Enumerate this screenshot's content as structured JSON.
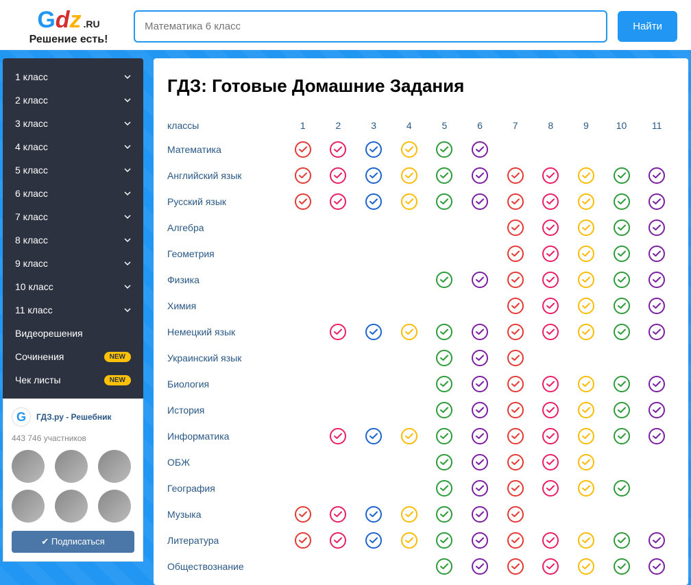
{
  "logo": {
    "g": "G",
    "d": "d",
    "z": "z",
    "ru": ".RU",
    "tagline": "Решение есть!"
  },
  "search": {
    "placeholder": "Математика 6 класс",
    "button": "Найти"
  },
  "nav": [
    {
      "label": "1 класс",
      "expandable": true
    },
    {
      "label": "2 класс",
      "expandable": true
    },
    {
      "label": "3 класс",
      "expandable": true
    },
    {
      "label": "4 класс",
      "expandable": true
    },
    {
      "label": "5 класс",
      "expandable": true
    },
    {
      "label": "6 класс",
      "expandable": true
    },
    {
      "label": "7 класс",
      "expandable": true
    },
    {
      "label": "8 класс",
      "expandable": true
    },
    {
      "label": "9 класс",
      "expandable": true
    },
    {
      "label": "10 класс",
      "expandable": true
    },
    {
      "label": "11 класс",
      "expandable": true
    },
    {
      "label": "Видеорешения",
      "expandable": false
    },
    {
      "label": "Сочинения",
      "expandable": false,
      "badge": "NEW"
    },
    {
      "label": "Чек листы",
      "expandable": false,
      "badge": "NEW"
    }
  ],
  "vk": {
    "title": "ГДЗ.ру - Решебник",
    "count": "443 746 участников",
    "button": "Подписаться"
  },
  "main": {
    "title": "ГДЗ: Готовые Домашние Задания",
    "classes_label": "классы",
    "cols": [
      "1",
      "2",
      "3",
      "4",
      "5",
      "6",
      "7",
      "8",
      "9",
      "10",
      "11"
    ],
    "colors": {
      "1": "#e53935",
      "2": "#e91e63",
      "3": "#1e62d0",
      "4": "#fbbc05",
      "5": "#2e9b3b",
      "6": "#7b1fa2",
      "7": "#e53935",
      "8": "#e91e63",
      "9": "#fbbc05",
      "10": "#2e9b3b",
      "11": "#7b1fa2"
    },
    "subjects": [
      {
        "name": "Математика",
        "grades": [
          1,
          2,
          3,
          4,
          5,
          6
        ]
      },
      {
        "name": "Английский язык",
        "grades": [
          1,
          2,
          3,
          4,
          5,
          6,
          7,
          8,
          9,
          10,
          11
        ]
      },
      {
        "name": "Русский язык",
        "grades": [
          1,
          2,
          3,
          4,
          5,
          6,
          7,
          8,
          9,
          10,
          11
        ]
      },
      {
        "name": "Алгебра",
        "grades": [
          7,
          8,
          9,
          10,
          11
        ]
      },
      {
        "name": "Геометрия",
        "grades": [
          7,
          8,
          9,
          10,
          11
        ]
      },
      {
        "name": "Физика",
        "grades": [
          5,
          6,
          7,
          8,
          9,
          10,
          11
        ]
      },
      {
        "name": "Химия",
        "grades": [
          7,
          8,
          9,
          10,
          11
        ]
      },
      {
        "name": "Немецкий язык",
        "grades": [
          2,
          3,
          4,
          5,
          6,
          7,
          8,
          9,
          10,
          11
        ]
      },
      {
        "name": "Украинский язык",
        "grades": [
          5,
          6,
          7
        ]
      },
      {
        "name": "Биология",
        "grades": [
          5,
          6,
          7,
          8,
          9,
          10,
          11
        ]
      },
      {
        "name": "История",
        "grades": [
          5,
          6,
          7,
          8,
          9,
          10,
          11
        ]
      },
      {
        "name": "Информатика",
        "grades": [
          2,
          3,
          4,
          5,
          6,
          7,
          8,
          9,
          10,
          11
        ]
      },
      {
        "name": "ОБЖ",
        "grades": [
          5,
          6,
          7,
          8,
          9
        ]
      },
      {
        "name": "География",
        "grades": [
          5,
          6,
          7,
          8,
          9,
          10
        ]
      },
      {
        "name": "Музыка",
        "grades": [
          1,
          2,
          3,
          4,
          5,
          6,
          7
        ]
      },
      {
        "name": "Литература",
        "grades": [
          1,
          2,
          3,
          4,
          5,
          6,
          7,
          8,
          9,
          10,
          11
        ]
      },
      {
        "name": "Обществознание",
        "grades": [
          5,
          6,
          7,
          8,
          9,
          10,
          11
        ]
      }
    ]
  }
}
